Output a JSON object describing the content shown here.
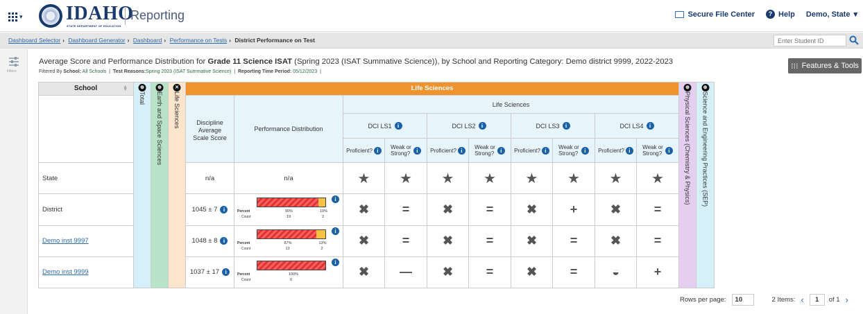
{
  "header": {
    "logo_text": "IDAHO",
    "logo_sub": "STATE DEPARTMENT OF EDUCATION",
    "app_name": "Reporting",
    "secure_file_center": "Secure File Center",
    "help": "Help",
    "user": "Demo, State"
  },
  "breadcrumbs": {
    "items": [
      "Dashboard Selector",
      "Dashboard Generator",
      "Dashboard",
      "Performance on Tests"
    ],
    "current": "District Performance on Test",
    "student_placeholder": "Enter Student ID"
  },
  "rail": {
    "label": "Filters"
  },
  "title": {
    "prefix": "Average Score and Performance Distribution for ",
    "test": "Grade 11 Science ISAT",
    "suffix": " (Spring 2023 (ISAT Summative Science)), by School and Reporting Category: Demo district 9999, 2022-2023"
  },
  "filters": {
    "filtered_by": "Filtered By",
    "school_label": "School:",
    "school_value": "All Schools",
    "reasons_label": "Test Reasons:",
    "reasons_value": "Spring 2023 (ISAT Summative Science)",
    "period_label": "Reporting Time Period:",
    "period_value": "05/12/2023"
  },
  "features_button": "Features & Tools",
  "table": {
    "school_header": "School",
    "total": "Total",
    "earth": "Earth and Space Sciences",
    "life_vertical": "Life Sciences",
    "life_band": "Life Sciences",
    "life_sub": "Life Sciences",
    "avg_header": [
      "Discipline",
      "Average",
      "Scale Score"
    ],
    "perf_header": "Performance Distribution",
    "dci": [
      "DCI LS1",
      "DCI LS2",
      "DCI LS3",
      "DCI LS4"
    ],
    "proficient": "Proficient?",
    "weak_strong_1": "Weak or",
    "weak_strong_2": "Strong?",
    "physical": "Physical Sciences (Chemistry & Physics)",
    "sep": "Science and Engineering Practices (SEP)",
    "pd_percent": "Percent",
    "pd_count": "Count",
    "rows": [
      {
        "name": "State",
        "link": false,
        "score": "n/a",
        "perf_text": "n/a",
        "symbols": [
          "★",
          "★",
          "★",
          "★",
          "★",
          "★",
          "★",
          "★"
        ]
      },
      {
        "name": "District",
        "link": false,
        "score": "1045 ± 7",
        "red_pct": 90,
        "yel_pct": 10,
        "p1": "90%",
        "p2": "10%",
        "c1": "19",
        "c2": "2",
        "symbols": [
          "✖",
          "=",
          "✖",
          "=",
          "✖",
          "+",
          "✖",
          "="
        ]
      },
      {
        "name": "Demo inst 9997",
        "link": true,
        "score": "1048 ± 8",
        "red_pct": 87,
        "yel_pct": 13,
        "p1": "87%",
        "p2": "13%",
        "c1": "13",
        "c2": "2",
        "symbols": [
          "✖",
          "=",
          "✖",
          "=",
          "✖",
          "=",
          "✖",
          "="
        ]
      },
      {
        "name": "Demo inst 9999",
        "link": true,
        "score": "1037 ± 17",
        "red_pct": 100,
        "yel_pct": 0,
        "p1": "100%",
        "p2": "",
        "c1": "6",
        "c2": "",
        "symbols": [
          "✖",
          "—",
          "✖",
          "=",
          "✖",
          "=",
          "◒",
          "+"
        ]
      }
    ]
  },
  "pager": {
    "rows_per_page_label": "Rows per page:",
    "rows_per_page": "10",
    "items": "2 Items:",
    "page": "1",
    "of": "of 1"
  }
}
